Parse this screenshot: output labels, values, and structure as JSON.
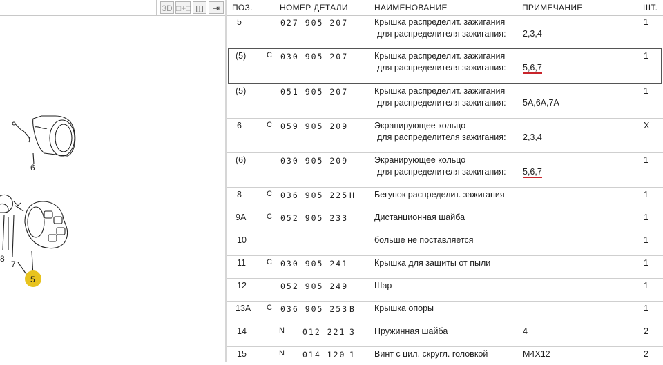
{
  "toolbar": {
    "btn_3d": "3D",
    "btn_link": "□+□",
    "btn_split": "◫",
    "btn_arrows": "⇥"
  },
  "diagram": {
    "labels": [
      "6",
      "8",
      "7",
      "5"
    ]
  },
  "table": {
    "headers": {
      "pos": "ПОЗ.",
      "part": "НОМЕР ДЕТАЛИ",
      "name": "НАИМЕНОВАНИЕ",
      "note": "ПРИМЕЧАНИЕ",
      "qty": "ШТ."
    },
    "rows": [
      {
        "pos": "5",
        "c": "",
        "part": "027 905 207",
        "suffix": "",
        "name1": "Крышка распределит. зажигания",
        "name2": "для распределителя зажигания:",
        "note": "2,3,4",
        "qty": "1"
      },
      {
        "pos": "(5)",
        "c": "C",
        "part": "030 905 207",
        "suffix": "",
        "name1": "Крышка распределит. зажигания",
        "name2": "для распределителя зажигания:",
        "note": "5,6,7",
        "qty": "1"
      },
      {
        "pos": "(5)",
        "c": "",
        "part": "051 905 207",
        "suffix": "",
        "name1": "Крышка распределит. зажигания",
        "name2": "для распределителя зажигания:",
        "note": "5A,6A,7A",
        "qty": "1"
      },
      {
        "pos": "6",
        "c": "C",
        "part": "059 905 209",
        "suffix": "",
        "name1": "Экранирующее кольцо",
        "name2": "для распределителя зажигания:",
        "note": "2,3,4",
        "qty": "X"
      },
      {
        "pos": "(6)",
        "c": "",
        "part": "030 905 209",
        "suffix": "",
        "name1": "Экранирующее кольцо",
        "name2": "для распределителя зажигания:",
        "note": "5,6,7",
        "qty": "1"
      },
      {
        "pos": "8",
        "c": "C",
        "part": "036 905 225",
        "suffix": "H",
        "name1": "Бегунок распределит. зажигания",
        "name2": "",
        "note": "",
        "qty": "1"
      },
      {
        "pos": "9A",
        "c": "C",
        "part": "052 905 233",
        "suffix": "",
        "name1": "Дистанционная шайба",
        "name2": "",
        "note": "",
        "qty": "1"
      },
      {
        "pos": "10",
        "c": "",
        "part": "",
        "suffix": "",
        "name1": "больше не поставляется",
        "name2": "",
        "note": "",
        "qty": "1"
      },
      {
        "pos": "11",
        "c": "C",
        "part": "030 905 241",
        "suffix": "",
        "name1": "Крышка для защиты от пыли",
        "name2": "",
        "note": "",
        "qty": "1"
      },
      {
        "pos": "12",
        "c": "",
        "part": "052 905 249",
        "suffix": "",
        "name1": "Шар",
        "name2": "",
        "note": "",
        "qty": "1"
      },
      {
        "pos": "13A",
        "c": "C",
        "part": "036 905 253",
        "suffix": "B",
        "name1": "Крышка опоры",
        "name2": "",
        "note": "",
        "qty": "1"
      },
      {
        "pos": "14",
        "c": "N",
        "part": "012 221",
        "suffix": "3",
        "name1": "Пружинная шайба",
        "name2": "",
        "note": "4",
        "qty": "2"
      },
      {
        "pos": "15",
        "c": "N",
        "part": "014 120",
        "suffix": "1",
        "name1": "Винт с цил. скругл. головкой",
        "name2": "",
        "note": "M4X12",
        "qty": "2"
      }
    ]
  },
  "colors": {
    "accent_underline": "#c9242b",
    "callout_badge": "#e8c31e"
  }
}
